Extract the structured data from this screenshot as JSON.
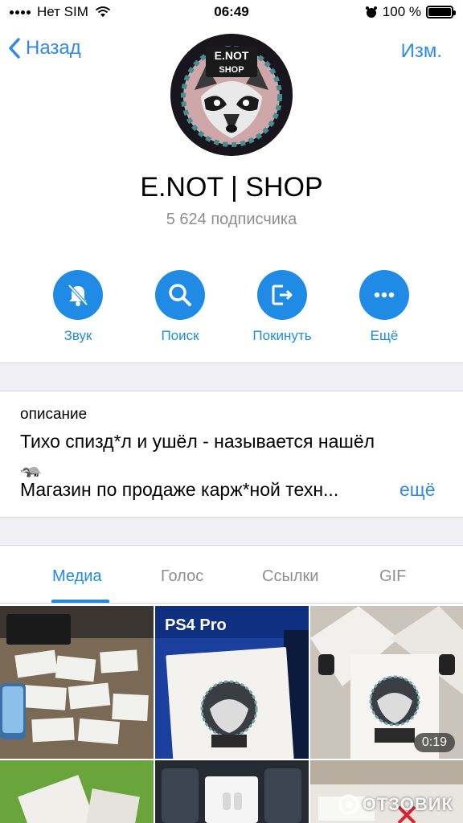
{
  "status_bar": {
    "carrier": "Нет SIM",
    "time": "06:49",
    "battery_percent": "100 %",
    "battery_level": 1.0
  },
  "nav": {
    "back_label": "Назад",
    "edit_label": "Изм."
  },
  "channel": {
    "logo_text_line1": "E.NOT",
    "logo_text_line2": "SHOP",
    "name": "E.NOT | SHOP",
    "subscribers": "5 624 подписчика"
  },
  "actions": [
    {
      "label": "Звук",
      "icon": "bell-slash-icon"
    },
    {
      "label": "Поиск",
      "icon": "search-icon"
    },
    {
      "label": "Покинуть",
      "icon": "leave-icon"
    },
    {
      "label": "Ещё",
      "icon": "more-icon"
    }
  ],
  "description": {
    "label": "описание",
    "line1": "Тихо спизд*л и ушёл - называется нашёл",
    "emoji": "🦡",
    "line2": "Магазин по продаже карж*ной техн...",
    "more_label": "ещё"
  },
  "tabs": [
    "Медиа",
    "Голос",
    "Ссылки",
    "GIF"
  ],
  "active_tab": "Медиа",
  "media": {
    "video_duration": "0:19",
    "ps4_label": "PS4 Pro",
    "watermark": "ОТЗОВИК"
  },
  "colors": {
    "accent": "#1f8be5",
    "link": "#2f8ae5",
    "secondary_text": "#8e8e93",
    "separator_band": "#efeff4"
  }
}
